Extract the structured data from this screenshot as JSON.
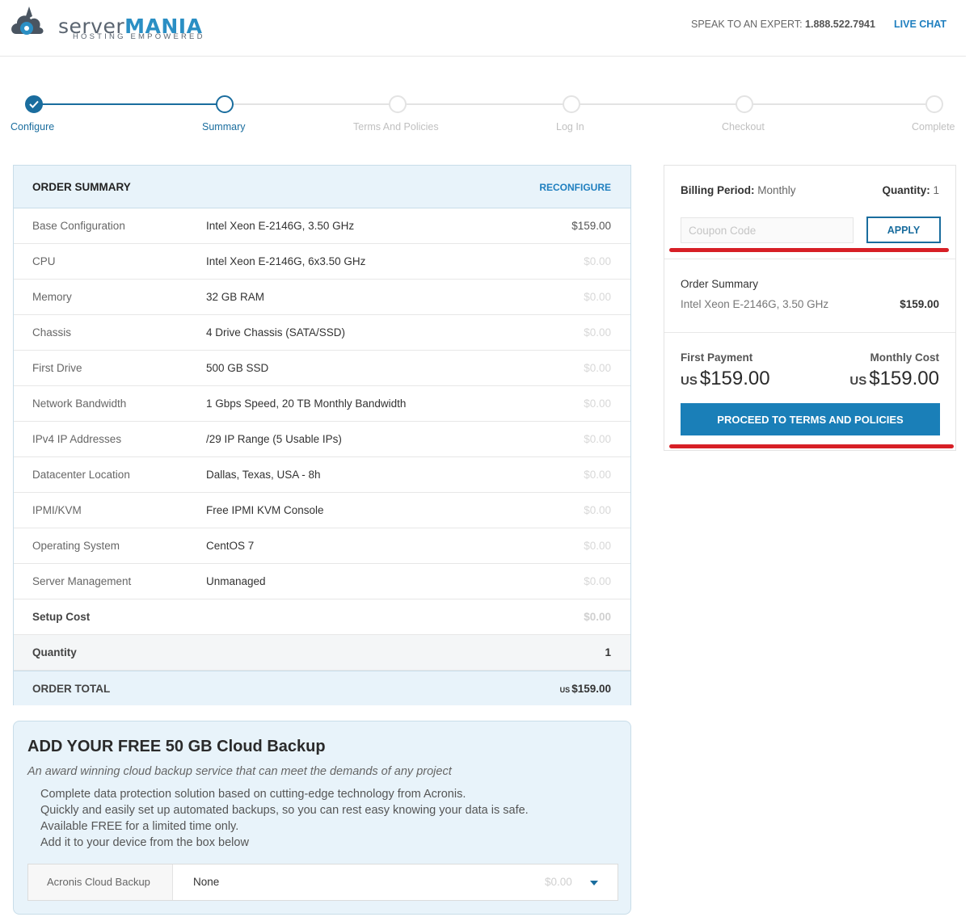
{
  "header": {
    "logo_word1": "server",
    "logo_word2": "MANIA",
    "logo_tagline": "HOSTING EMPOWERED",
    "speak_label": "SPEAK TO AN EXPERT:",
    "phone": "1.888.522.7941",
    "live_chat": "LIVE CHAT"
  },
  "steps": [
    {
      "label": "Configure",
      "state": "done"
    },
    {
      "label": "Summary",
      "state": "current"
    },
    {
      "label": "Terms And Policies",
      "state": "todo"
    },
    {
      "label": "Log In",
      "state": "todo"
    },
    {
      "label": "Checkout",
      "state": "todo"
    },
    {
      "label": "Complete",
      "state": "todo"
    }
  ],
  "order": {
    "title": "ORDER SUMMARY",
    "reconfigure": "RECONFIGURE",
    "rows": [
      {
        "key": "Base Configuration",
        "value": "Intel Xeon E-2146G, 3.50 GHz",
        "price": "$159.00"
      },
      {
        "key": "CPU",
        "value": "Intel Xeon E-2146G, 6x3.50 GHz",
        "price": "$0.00"
      },
      {
        "key": "Memory",
        "value": "32 GB RAM",
        "price": "$0.00"
      },
      {
        "key": "Chassis",
        "value": "4 Drive Chassis (SATA/SSD)",
        "price": "$0.00"
      },
      {
        "key": "First Drive",
        "value": "500 GB SSD",
        "price": "$0.00"
      },
      {
        "key": "Network Bandwidth",
        "value": "1 Gbps Speed, 20 TB Monthly Bandwidth",
        "price": "$0.00"
      },
      {
        "key": "IPv4 IP Addresses",
        "value": "/29 IP Range (5 Usable IPs)",
        "price": "$0.00"
      },
      {
        "key": "Datacenter Location",
        "value": "Dallas, Texas, USA - 8h",
        "price": "$0.00"
      },
      {
        "key": "IPMI/KVM",
        "value": "Free IPMI KVM Console",
        "price": "$0.00"
      },
      {
        "key": "Operating System",
        "value": "CentOS 7",
        "price": "$0.00"
      },
      {
        "key": "Server Management",
        "value": "Unmanaged",
        "price": "$0.00"
      }
    ],
    "setup_label": "Setup Cost",
    "setup_price": "$0.00",
    "quantity_label": "Quantity",
    "quantity_value": "1",
    "total_label": "ORDER TOTAL",
    "total_currency": "US",
    "total_value": "$159.00"
  },
  "backup": {
    "title": "ADD YOUR FREE 50 GB Cloud Backup",
    "subtitle": "An award winning cloud backup service that can meet the demands of any project",
    "lines": [
      "Complete data protection solution based on cutting-edge technology from Acronis.",
      "Quickly and easily set up automated backups, so you can rest easy knowing your data is safe.",
      "Available FREE for a limited time only.",
      "Add it to your device from the box below"
    ],
    "select_label": "Acronis Cloud Backup",
    "select_value": "None",
    "select_price": "$0.00"
  },
  "panel": {
    "billing_label": "Billing Period:",
    "billing_value": "Monthly",
    "quantity_label": "Quantity:",
    "quantity_value": "1",
    "coupon_placeholder": "Coupon Code",
    "apply": "APPLY",
    "summary_title": "Order Summary",
    "summary_item": "Intel Xeon E-2146G, 3.50 GHz",
    "summary_price": "$159.00",
    "first_payment_label": "First Payment",
    "monthly_cost_label": "Monthly Cost",
    "currency": "US",
    "first_payment": "$159.00",
    "monthly_cost": "$159.00",
    "proceed": "PROCEED TO TERMS AND POLICIES"
  },
  "colors": {
    "accent": "#1a6d9e",
    "link": "#1f7fbf",
    "button": "#1a7fb8",
    "highlight_line": "#d71f26",
    "panel_bg": "#e8f3fa"
  }
}
